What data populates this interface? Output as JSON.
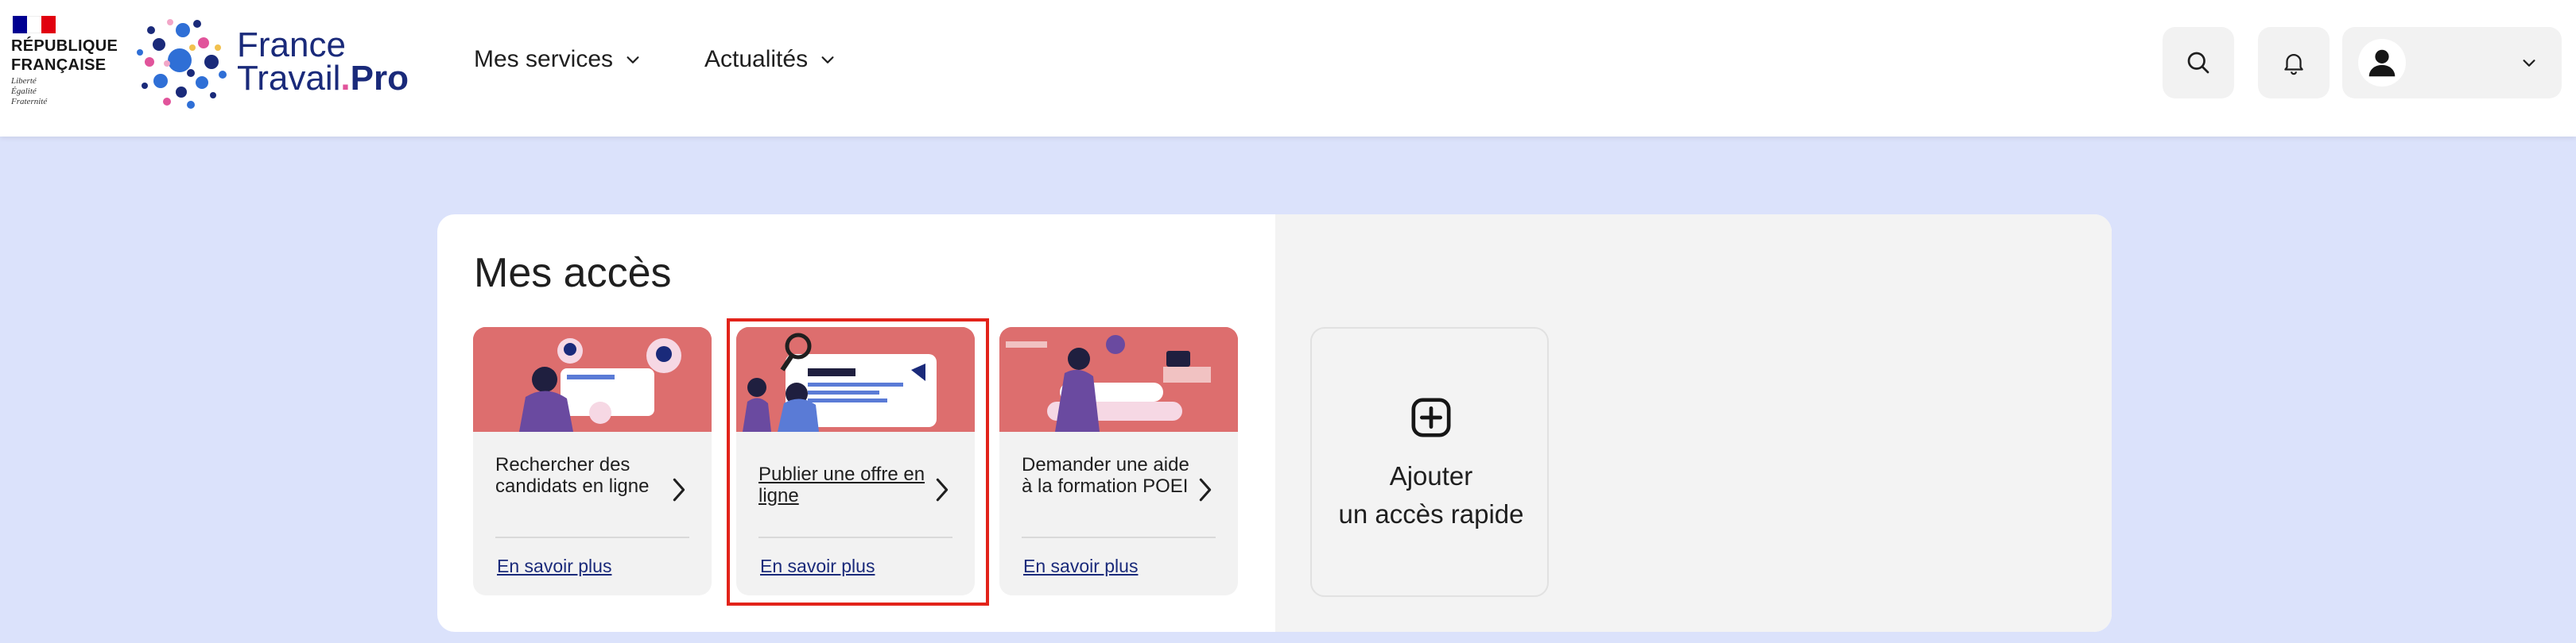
{
  "header": {
    "republic": {
      "title": "RÉPUBLIQUE\nFRANÇAISE",
      "motto": "Liberté\nÉgalité\nFraternité"
    },
    "brand": {
      "line1": "France",
      "line2a": "Travail",
      "line2dot": ".",
      "line2b": "Pro"
    },
    "nav": [
      {
        "label": "Mes services",
        "icon": "chevron-down-icon"
      },
      {
        "label": "Actualités",
        "icon": "chevron-down-icon"
      }
    ],
    "actions": {
      "search_icon": "search-icon",
      "notifications_icon": "bell-icon",
      "account_icon": "user-avatar-icon"
    }
  },
  "main": {
    "title": "Mes accès",
    "cards": [
      {
        "title": "Rechercher des candidats en ligne",
        "more": "En savoir plus"
      },
      {
        "title": "Publier une offre en ligne",
        "more": "En savoir plus"
      },
      {
        "title": "Demander une aide à la formation POEI",
        "more": "En savoir plus"
      }
    ],
    "add_tile": {
      "label_line1": "Ajouter",
      "label_line2": "un accès rapide",
      "icon": "plus-square-icon"
    }
  },
  "colors": {
    "page_bg": "#dbe2fb",
    "brand_navy": "#1a2a7a",
    "card_illustration": "#dd6e6e",
    "highlight": "#e2231a"
  }
}
